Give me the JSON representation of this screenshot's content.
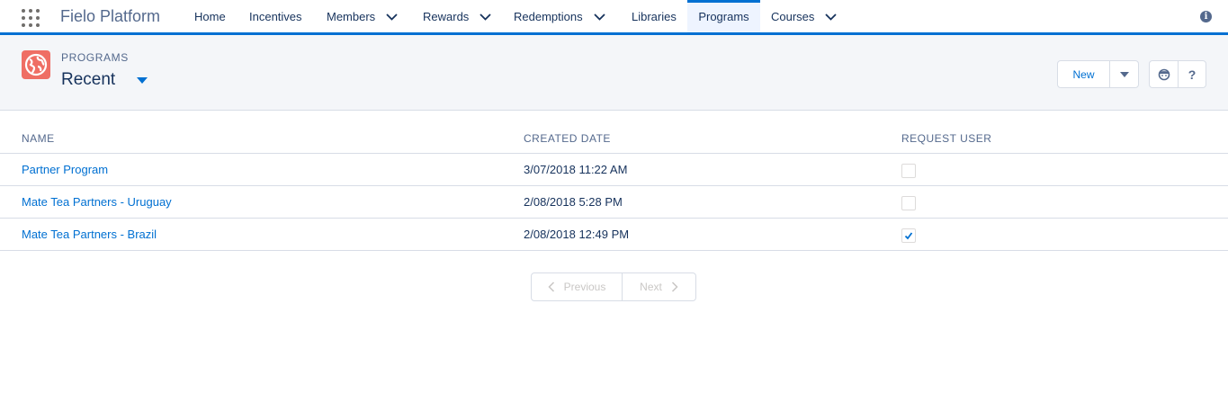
{
  "app": {
    "name": "Fielo Platform"
  },
  "nav": {
    "items": [
      {
        "label": "Home",
        "has_menu": false,
        "active": false
      },
      {
        "label": "Incentives",
        "has_menu": false,
        "active": false
      },
      {
        "label": "Members",
        "has_menu": true,
        "active": false
      },
      {
        "label": "Rewards",
        "has_menu": true,
        "active": false
      },
      {
        "label": "Redemptions",
        "has_menu": true,
        "active": false
      },
      {
        "label": "Libraries",
        "has_menu": false,
        "active": false
      },
      {
        "label": "Programs",
        "has_menu": false,
        "active": true
      },
      {
        "label": "Courses",
        "has_menu": true,
        "active": false
      }
    ],
    "info_icon": "info-icon",
    "info_glyph": "i"
  },
  "header": {
    "object_label": "PROGRAMS",
    "list_view": "Recent",
    "new_button": "New",
    "help_glyph": "?",
    "icons": {
      "object": "globe-icon",
      "dropdown": "caret-down-icon",
      "feedback": "face-icon",
      "help": "question-icon"
    },
    "accent_color": "#0070d2",
    "object_icon_color": "#ef6e64"
  },
  "table": {
    "columns": [
      "NAME",
      "CREATED DATE",
      "REQUEST USER"
    ],
    "rows": [
      {
        "name": "Partner Program",
        "created": "3/07/2018 11:22 AM",
        "request_user": false
      },
      {
        "name": "Mate Tea Partners - Uruguay",
        "created": "2/08/2018 5:28 PM",
        "request_user": false
      },
      {
        "name": "Mate Tea Partners - Brazil",
        "created": "2/08/2018 12:49 PM",
        "request_user": true
      }
    ]
  },
  "pagination": {
    "previous": "Previous",
    "next": "Next"
  }
}
